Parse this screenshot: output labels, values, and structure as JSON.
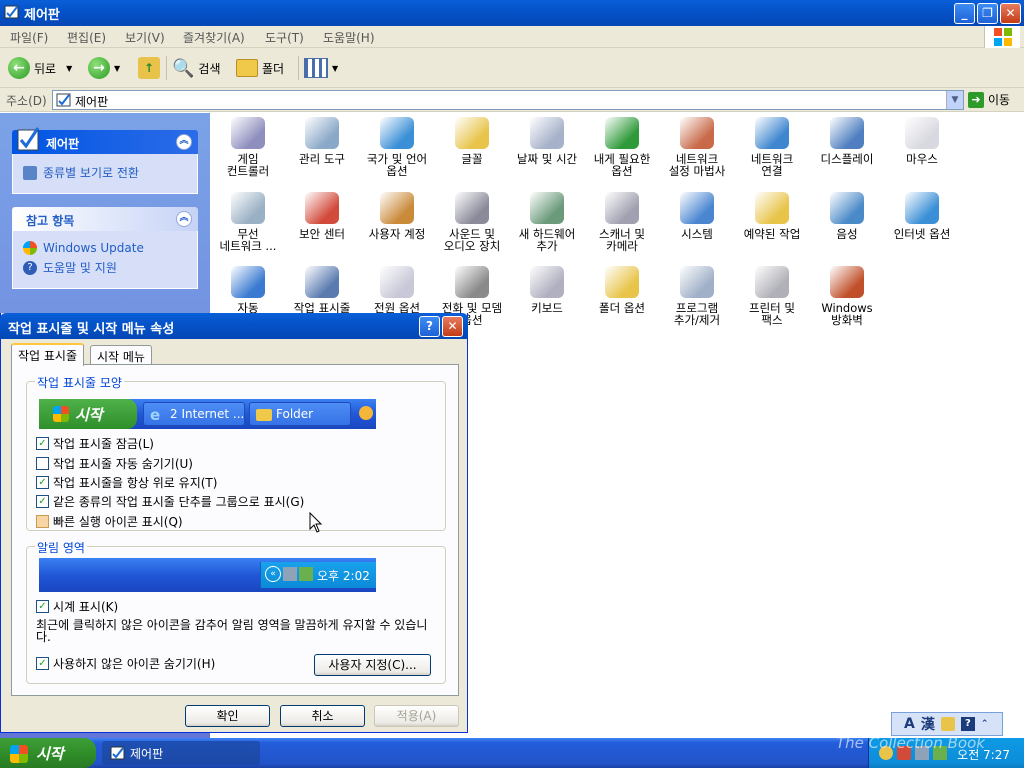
{
  "window": {
    "title": "제어판",
    "menu": [
      "파일(F)",
      "편집(E)",
      "보기(V)",
      "즐겨찾기(A)",
      "도구(T)",
      "도움말(H)"
    ],
    "toolbar": {
      "back": "뒤로",
      "search": "검색",
      "folders": "폴더"
    },
    "address": {
      "label": "주소(D)",
      "value": "제어판",
      "go": "이동"
    }
  },
  "left_pane": {
    "panel1": {
      "title": "제어판",
      "link": "종류별 보기로 전환"
    },
    "panel2": {
      "title": "참고 항목",
      "links": [
        "Windows Update",
        "도움말 및 지원"
      ]
    }
  },
  "items": [
    {
      "l1": "게임",
      "l2": "컨트롤러",
      "color": "#8f8fbf"
    },
    {
      "l1": "관리 도구",
      "l2": "",
      "color": "#8aa8c8"
    },
    {
      "l1": "국가 및 언어",
      "l2": "옵션",
      "color": "#3a8fd6"
    },
    {
      "l1": "글꼴",
      "l2": "",
      "color": "#e8c44a"
    },
    {
      "l1": "날짜 및 시간",
      "l2": "",
      "color": "#a6b2c9"
    },
    {
      "l1": "내게 필요한",
      "l2": "옵션",
      "color": "#2f9a3a"
    },
    {
      "l1": "네트워크",
      "l2": "설정 마법사",
      "color": "#c86a4a"
    },
    {
      "l1": "네트워크",
      "l2": "연결",
      "color": "#3e86cf"
    },
    {
      "l1": "디스플레이",
      "l2": "",
      "color": "#4f7fc0"
    },
    {
      "l1": "마우스",
      "l2": "",
      "color": "#d8d8e0"
    },
    {
      "l1": "무선",
      "l2": "네트워크 ...",
      "color": "#9ab0c4"
    },
    {
      "l1": "보안 센터",
      "l2": "",
      "color": "#d24a3a"
    },
    {
      "l1": "사용자 계정",
      "l2": "",
      "color": "#c98a3a"
    },
    {
      "l1": "사운드 및",
      "l2": "오디오 장치",
      "color": "#8a8a9a"
    },
    {
      "l1": "새 하드웨어",
      "l2": "추가",
      "color": "#6a9a7a"
    },
    {
      "l1": "스캐너 및",
      "l2": "카메라",
      "color": "#a0a0b0"
    },
    {
      "l1": "시스템",
      "l2": "",
      "color": "#4a86d0"
    },
    {
      "l1": "예약된 작업",
      "l2": "",
      "color": "#e8c44a"
    },
    {
      "l1": "음성",
      "l2": "",
      "color": "#4a8ac8"
    },
    {
      "l1": "인터넷 옵션",
      "l2": "",
      "color": "#3a8fd6"
    },
    {
      "l1": "자동",
      "l2": "",
      "color": "#3a7ad0"
    },
    {
      "l1": "작업 표시줄",
      "l2": "",
      "color": "#5a7ab0"
    },
    {
      "l1": "전원 옵션",
      "l2": "",
      "color": "#c8c8d8"
    },
    {
      "l1": "전화 및 모뎀",
      "l2": "옵션",
      "color": "#8a8a8a"
    },
    {
      "l1": "키보드",
      "l2": "",
      "color": "#b0b0c0"
    },
    {
      "l1": "폴더 옵션",
      "l2": "",
      "color": "#e8c44a"
    },
    {
      "l1": "프로그램",
      "l2": "추가/제거",
      "color": "#a0b0c8"
    },
    {
      "l1": "프린터 및",
      "l2": "팩스",
      "color": "#b0b0b8"
    },
    {
      "l1": "Windows",
      "l2": "방화벽",
      "color": "#c0502a"
    }
  ],
  "dialog": {
    "title": "작업 표시줄 및 시작 메뉴 속성",
    "tabs": [
      "작업 표시줄",
      "시작 메뉴"
    ],
    "group1": "작업 표시줄 모양",
    "preview": {
      "start": "시작",
      "btn1": "2 Internet ...",
      "btn2": "Folder"
    },
    "checks": [
      {
        "label": "작업 표시줄 잠금(L)",
        "checked": true
      },
      {
        "label": "작업 표시줄 자동 숨기기(U)",
        "checked": false
      },
      {
        "label": "작업 표시줄을 항상 위로 유지(T)",
        "checked": true
      },
      {
        "label": "같은 종류의 작업 표시줄 단추를 그룹으로 표시(G)",
        "checked": true
      },
      {
        "label": "빠른 실행 아이콘 표시(Q)",
        "checked": false
      }
    ],
    "group2": "알림 영역",
    "tray_time": "오후 2:02",
    "clock_label": "시계 표시(K)",
    "desc": "최근에 클릭하지 않은 아이콘을 감추어 알림 영역을 말끔하게 유지할 수 있습니다.",
    "hide_label": "사용하지 않은 아이콘 숨기기(H)",
    "customize": "사용자 지정(C)...",
    "ok": "확인",
    "cancel": "취소",
    "apply": "적용(A)"
  },
  "taskbar": {
    "start": "시작",
    "task": "제어판",
    "clock": "오전 7:27",
    "lang_a": "A",
    "lang_han": "漢"
  },
  "watermark": "The Collection Book"
}
